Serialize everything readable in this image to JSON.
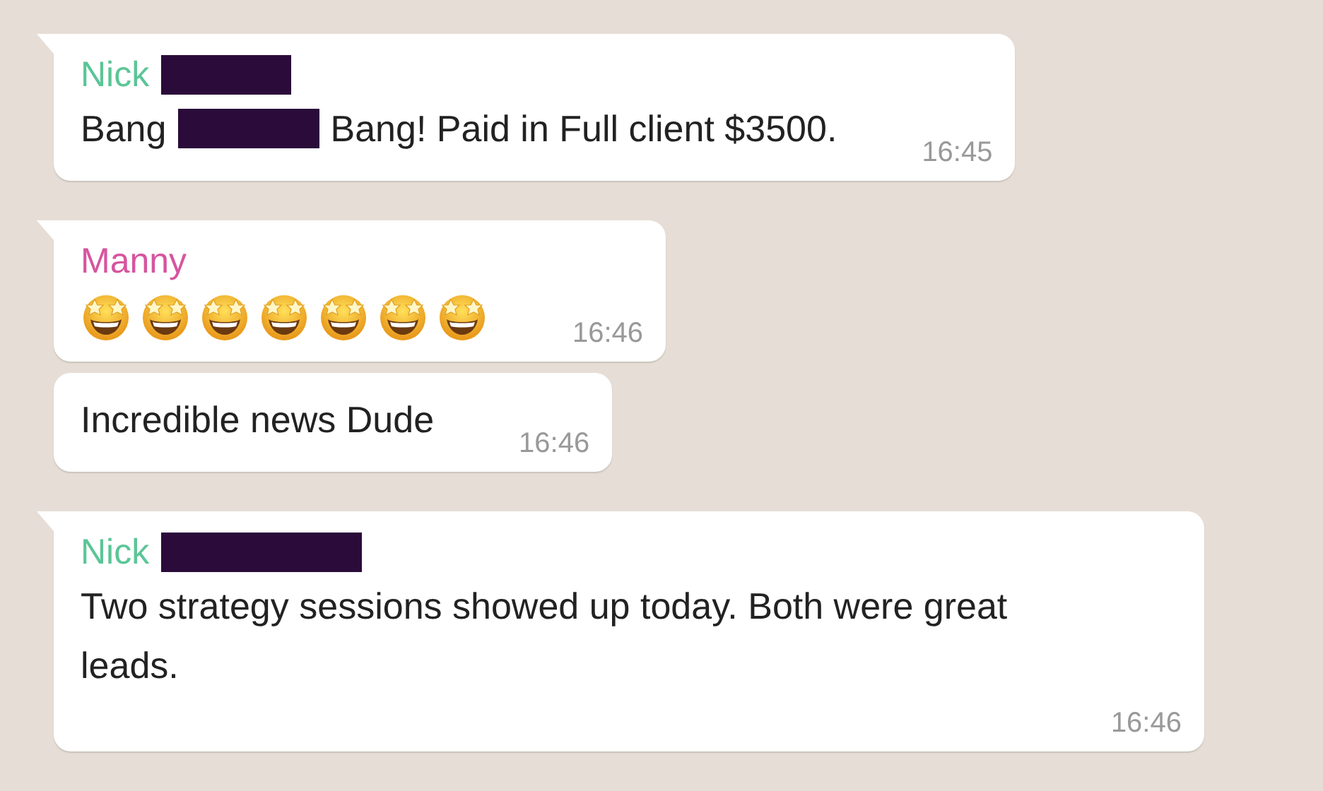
{
  "messages": [
    {
      "tail": true,
      "sender": {
        "name": "Nick",
        "color": "#5cc597"
      },
      "parts": [
        {
          "kind": "redaction"
        }
      ],
      "body": [
        {
          "kind": "text",
          "text": "Bang"
        },
        {
          "kind": "redaction"
        },
        {
          "kind": "text",
          "text": "Bang! Paid in Full client $3500."
        }
      ],
      "time": "16:45"
    },
    {
      "tail": true,
      "sender": {
        "name": "Manny",
        "color": "#d6559f"
      },
      "body": [
        {
          "kind": "emoji"
        },
        {
          "kind": "emoji"
        },
        {
          "kind": "emoji"
        },
        {
          "kind": "emoji"
        },
        {
          "kind": "emoji"
        },
        {
          "kind": "emoji"
        },
        {
          "kind": "emoji"
        }
      ],
      "time": "16:46"
    },
    {
      "tail": false,
      "body": [
        {
          "kind": "text",
          "text": "Incredible news Dude"
        }
      ],
      "time": "16:46"
    },
    {
      "tail": true,
      "sender": {
        "name": "Nick",
        "color": "#5cc597"
      },
      "parts": [
        {
          "kind": "redaction"
        }
      ],
      "body": [
        {
          "kind": "text",
          "text": "Two strategy sessions showed up today. Both were great leads."
        }
      ],
      "time": "16:46"
    }
  ]
}
